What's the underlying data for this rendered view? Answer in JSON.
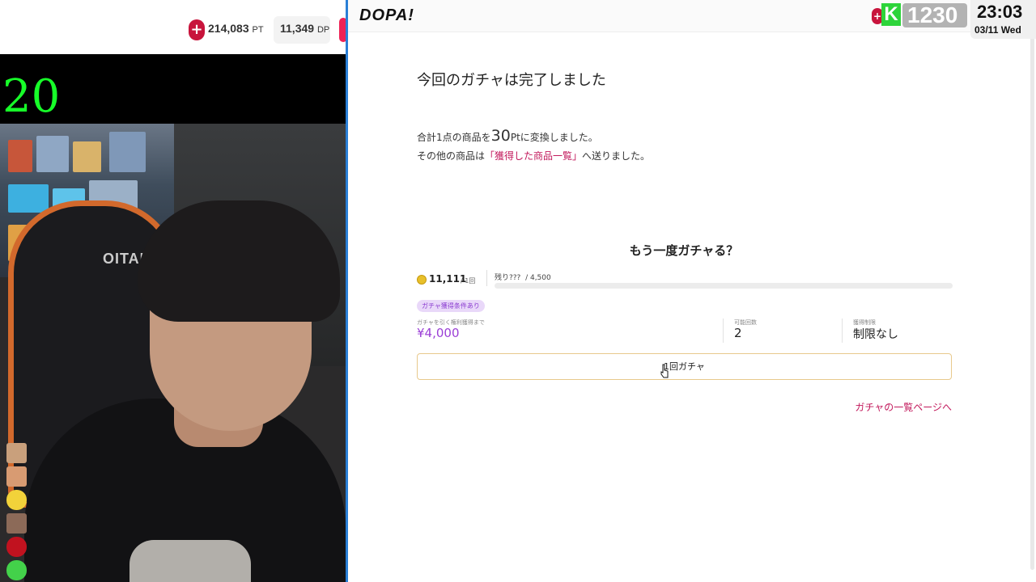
{
  "stream": {
    "pt": {
      "value": "214,083",
      "unit": "PT"
    },
    "dp": {
      "value": "11,349",
      "unit": "DP"
    },
    "counter": "20",
    "chair_brand": "OITAMO"
  },
  "overlay": {
    "score": "1230",
    "k_badge": "K",
    "time": "23:03",
    "date": "03/11 Wed"
  },
  "site": {
    "logo": "DOPA!",
    "completed_title": "今回のガチャは完了しました",
    "convert_line": {
      "prefix": "合計1点の商品を",
      "points": "30",
      "suffix": "Ptに変換しました。"
    },
    "sent_line": {
      "prefix": "その他の商品は",
      "link": "「獲得した商品一覧」",
      "suffix": "へ送りました。"
    },
    "again_title": "もう一度ガチャる？",
    "price": {
      "amount": "11,111",
      "per": "/ 1回"
    },
    "remaining": {
      "label": "残り???",
      "total": "/ 4,500"
    },
    "condition_badge": "ガチャ獲得条件あり",
    "right_to_draw": {
      "label": "ガチャを引く権利獲得まで",
      "amount": "¥4,000"
    },
    "possible_times": {
      "label": "可能回数",
      "value": "2"
    },
    "acquisition_limit": {
      "label": "獲得制限",
      "value": "制限なし"
    },
    "gacha_button": "1回ガチャ",
    "list_link": "ガチャの一覧ページへ"
  },
  "colors": {
    "accent_link": "#c2185b",
    "purple": "#9b3fd6",
    "button_border": "#e8c98c",
    "counter_green": "#17ff29",
    "divider_blue": "#2a7fd6"
  }
}
